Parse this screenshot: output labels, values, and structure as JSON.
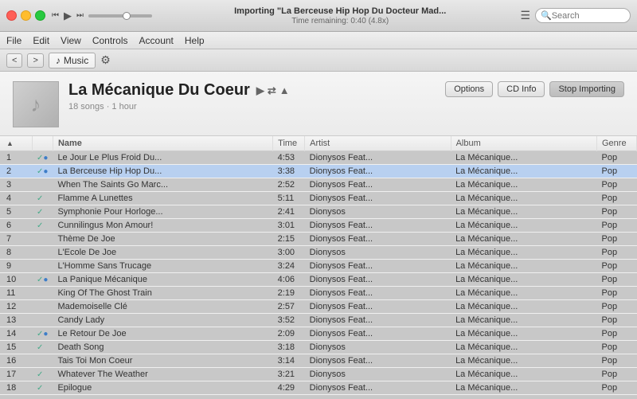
{
  "window": {
    "title": "Importing \"La Berceuse Hip Hop Du Docteur Mad...",
    "subtitle": "Time remaining: 0:40 (4.8x)",
    "close_label": "",
    "minimize_label": "",
    "maximize_label": ""
  },
  "search": {
    "placeholder": "Search"
  },
  "menu": {
    "items": [
      "File",
      "Edit",
      "View",
      "Controls",
      "Account",
      "Help"
    ]
  },
  "toolbar": {
    "back_label": "<",
    "forward_label": ">",
    "location": "Music",
    "gear_icon": "⚙"
  },
  "album": {
    "title": "La Mécanique Du Coeur",
    "subtitle": "18 songs · 1 hour",
    "note_icon": "♪",
    "buttons": [
      "Options",
      "CD Info",
      "Stop Importing"
    ]
  },
  "table": {
    "headers": [
      "#",
      "",
      "Name",
      "Time",
      "Artist",
      "Album",
      "Genre"
    ],
    "rows": [
      {
        "num": "1",
        "status": "✓●",
        "name": "Le Jour Le Plus Froid Du...",
        "time": "4:53",
        "artist": "Dionysos Feat...",
        "album": "La Mécanique...",
        "genre": "Pop",
        "importing": true,
        "done": false
      },
      {
        "num": "2",
        "status": "✓●",
        "name": "La Berceuse Hip Hop Du...",
        "time": "3:38",
        "artist": "Dionysos Feat...",
        "album": "La Mécanique...",
        "genre": "Pop",
        "importing": true,
        "done": false,
        "active": true
      },
      {
        "num": "3",
        "status": "",
        "name": "When The Saints Go Marc...",
        "time": "2:52",
        "artist": "Dionysos Feat...",
        "album": "La Mécanique...",
        "genre": "Pop"
      },
      {
        "num": "4",
        "status": "✓",
        "name": "Flamme A Lunettes",
        "time": "5:11",
        "artist": "Dionysos Feat...",
        "album": "La Mécanique...",
        "genre": "Pop"
      },
      {
        "num": "5",
        "status": "✓",
        "name": "Symphonie Pour Horloge...",
        "time": "2:41",
        "artist": "Dionysos",
        "album": "La Mécanique...",
        "genre": "Pop"
      },
      {
        "num": "6",
        "status": "✓",
        "name": "Cunnilingus Mon Amour!",
        "time": "3:01",
        "artist": "Dionysos Feat...",
        "album": "La Mécanique...",
        "genre": "Pop"
      },
      {
        "num": "7",
        "status": "",
        "name": "Thème De Joe",
        "time": "2:15",
        "artist": "Dionysos Feat...",
        "album": "La Mécanique...",
        "genre": "Pop"
      },
      {
        "num": "8",
        "status": "",
        "name": "L'Ecole De Joe",
        "time": "3:00",
        "artist": "Dionysos",
        "album": "La Mécanique...",
        "genre": "Pop"
      },
      {
        "num": "9",
        "status": "",
        "name": "L'Homme Sans Trucage",
        "time": "3:24",
        "artist": "Dionysos Feat...",
        "album": "La Mécanique...",
        "genre": "Pop"
      },
      {
        "num": "10",
        "status": "✓●",
        "name": "La Panique Mécanique",
        "time": "4:06",
        "artist": "Dionysos Feat...",
        "album": "La Mécanique...",
        "genre": "Pop"
      },
      {
        "num": "11",
        "status": "",
        "name": "King Of The Ghost Train",
        "time": "2:19",
        "artist": "Dionysos Feat...",
        "album": "La Mécanique...",
        "genre": "Pop"
      },
      {
        "num": "12",
        "status": "",
        "name": "Mademoiselle Clé",
        "time": "2:57",
        "artist": "Dionysos Feat...",
        "album": "La Mécanique...",
        "genre": "Pop"
      },
      {
        "num": "13",
        "status": "",
        "name": "Candy Lady",
        "time": "3:52",
        "artist": "Dionysos Feat...",
        "album": "La Mécanique...",
        "genre": "Pop"
      },
      {
        "num": "14",
        "status": "✓●",
        "name": "Le Retour De Joe",
        "time": "2:09",
        "artist": "Dionysos Feat...",
        "album": "La Mécanique...",
        "genre": "Pop"
      },
      {
        "num": "15",
        "status": "✓",
        "name": "Death Song",
        "time": "3:18",
        "artist": "Dionysos",
        "album": "La Mécanique...",
        "genre": "Pop"
      },
      {
        "num": "16",
        "status": "",
        "name": "Tais Toi Mon Coeur",
        "time": "3:14",
        "artist": "Dionysos Feat...",
        "album": "La Mécanique...",
        "genre": "Pop"
      },
      {
        "num": "17",
        "status": "✓",
        "name": "Whatever The Weather",
        "time": "3:21",
        "artist": "Dionysos",
        "album": "La Mécanique...",
        "genre": "Pop"
      },
      {
        "num": "18",
        "status": "✓",
        "name": "Epilogue",
        "time": "4:29",
        "artist": "Dionysos Feat...",
        "album": "La Mécanique...",
        "genre": "Pop"
      }
    ]
  }
}
